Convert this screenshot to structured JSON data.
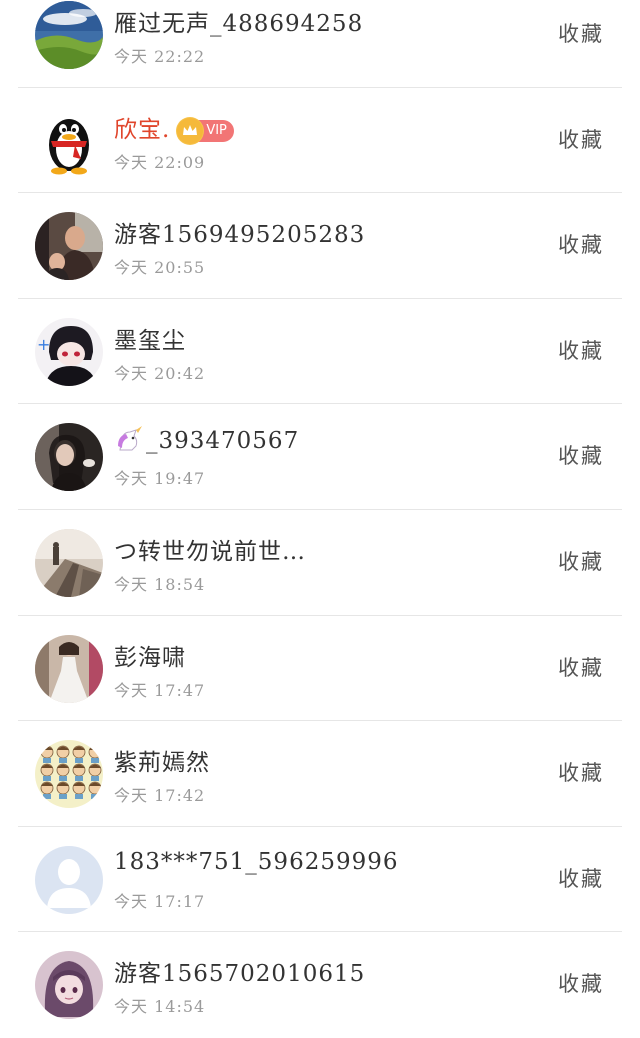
{
  "items": [
    {
      "name": "雁过无声_488694258",
      "time": "今天 22:22",
      "action": "收藏",
      "avatar_icon": "landscape-avatar-icon"
    },
    {
      "name": "欣宝.",
      "badge": "VIP",
      "time": "今天 22:09",
      "action": "收藏",
      "avatar_icon": "qq-penguin-avatar-icon"
    },
    {
      "name": "游客1569495205283",
      "time": "今天 20:55",
      "action": "收藏",
      "avatar_icon": "photo-avatar-icon"
    },
    {
      "name": "墨玺尘",
      "time": "今天 20:42",
      "action": "收藏",
      "avatar_icon": "anime-avatar-icon"
    },
    {
      "name": "_393470567",
      "name_emoji": "unicorn-emoji-icon",
      "time": "今天 19:47",
      "action": "收藏",
      "avatar_icon": "portrait-avatar-icon"
    },
    {
      "name": "つ转世勿说前世…",
      "time": "今天 18:54",
      "action": "收藏",
      "avatar_icon": "scenery-avatar-icon"
    },
    {
      "name": "彭海啸",
      "time": "今天 17:47",
      "action": "收藏",
      "avatar_icon": "dress-avatar-icon"
    },
    {
      "name": "紫荊嫣然",
      "time": "今天 17:42",
      "action": "收藏",
      "avatar_icon": "cartoon-grid-avatar-icon"
    },
    {
      "name": "183***751_596259996",
      "time": "今天 17:17",
      "action": "收藏",
      "avatar_icon": "default-user-avatar-icon"
    },
    {
      "name": "游客1565702010615",
      "time": "今天 14:54",
      "action": "收藏",
      "avatar_icon": "anime-girl-avatar-icon"
    }
  ],
  "colors": {
    "name": "#333333",
    "vip_name": "#e0452b",
    "time": "#9a9a9a",
    "divider": "#e6e6e6",
    "vip_badge": "#f27575"
  }
}
